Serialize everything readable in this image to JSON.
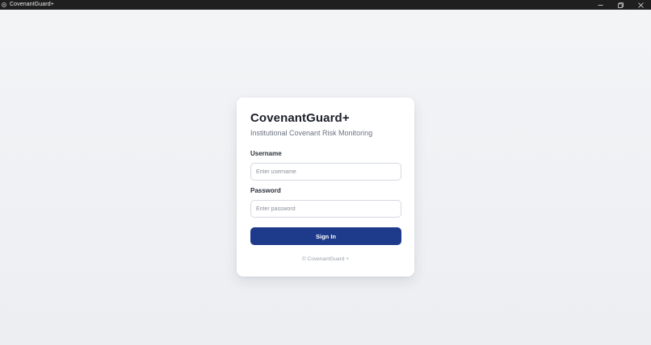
{
  "window": {
    "title": "CovenantGuard+",
    "icon": "app-icon",
    "controls": [
      "minimize-icon",
      "restore-icon",
      "close-icon"
    ]
  },
  "login": {
    "title": "CovenantGuard+",
    "subtitle": "Institutional Covenant Risk Monitoring",
    "username": {
      "label": "Username",
      "placeholder": "Enter username",
      "value": ""
    },
    "password": {
      "label": "Password",
      "placeholder": "Enter password",
      "value": ""
    },
    "submit_label": "Sign In",
    "footer": "© CovenantGuard +"
  },
  "colors": {
    "titlebar": "#1f1f1f",
    "background": "#eef0f4",
    "card": "#ffffff",
    "accent": "#1e3a8a",
    "title_text": "#1b1f2a",
    "subtitle_text": "#6b7280"
  }
}
